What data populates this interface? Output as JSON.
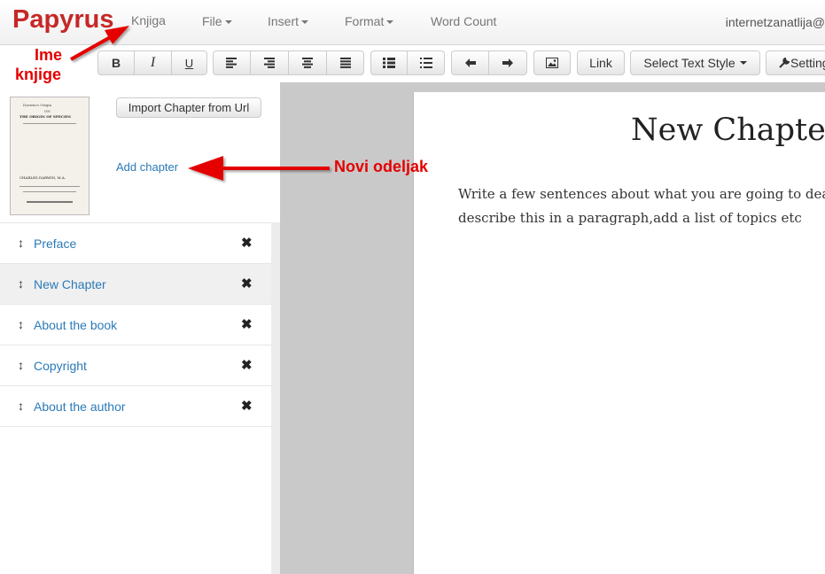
{
  "brand": "Papyrus",
  "nav": {
    "book": "Knjiga",
    "file": "File",
    "insert": "Insert",
    "format": "Format",
    "word_count": "Word Count",
    "user": "internetzanatlija@"
  },
  "toolbar": {
    "bold": "B",
    "italic": "I",
    "underline": "U",
    "link": "Link",
    "text_style": "Select Text Style",
    "settings": "Setting"
  },
  "sidebar": {
    "import_label": "Import Chapter from Url",
    "add_chapter": "Add chapter",
    "chapters": [
      {
        "label": "Preface",
        "active": false
      },
      {
        "label": "New Chapter",
        "active": true
      },
      {
        "label": "About the book",
        "active": false
      },
      {
        "label": "Copyright",
        "active": false
      },
      {
        "label": "About the author",
        "active": false
      }
    ]
  },
  "cover": {
    "line1": "Darwin's Origin",
    "line2": "ON",
    "line3": "THE ORIGIN OF SPECIES",
    "author": "CHARLES DARWIN, M.A."
  },
  "document": {
    "title": "New Chapter",
    "body_line1": "Write a few sentences about what you are going to deal",
    "body_line2": "describe this in a paragraph,add a list of topics etc"
  },
  "annotations": {
    "book_name_line1": "Ime",
    "book_name_line2": "knjige",
    "new_section": "Novi odeljak"
  },
  "colors": {
    "brand": "#c62828",
    "link": "#2a7ab8",
    "annotation": "#e50000"
  }
}
